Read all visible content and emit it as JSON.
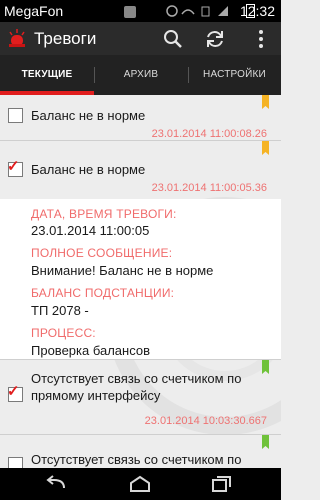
{
  "status_bar": {
    "carrier": "MegaFon",
    "time": "12:32"
  },
  "app_bar": {
    "title": "Тревоги",
    "icons": [
      "alarm-siren-icon",
      "search-icon",
      "refresh-icon",
      "overflow-menu-icon"
    ]
  },
  "tabs": [
    {
      "label": "ТЕКУЩИЕ",
      "active": true
    },
    {
      "label": "АРХИВ",
      "active": false
    },
    {
      "label": "НАСТРОЙКИ",
      "active": false
    }
  ],
  "alarms": [
    {
      "text": "Баланс не в норме",
      "date": "23.01.2014 11:00:08.26",
      "checked": false,
      "color": "#f5b324"
    },
    {
      "text": "Баланс не в норме",
      "date": "23.01.2014 11:00:05.36",
      "checked": true,
      "color": "#f5b324"
    },
    {
      "text": "Отсутствует связь со счетчиком по прямому интерфейсу",
      "date": "23.01.2014 10:03:30.667",
      "checked": true,
      "color": "#6fc23a"
    },
    {
      "text": "Отсутствует связь со счетчиком по",
      "checked": false,
      "color": "#6fc23a"
    }
  ],
  "details": {
    "datetime_label": "ДАТА, ВРЕМЯ ТРЕВОГИ:",
    "datetime_value": "23.01.2014 11:00:05",
    "message_label": "ПОЛНОЕ СООБЩЕНИЕ:",
    "message_value": "Внимание! Баланс не в норме",
    "substation_label": "БАЛАНС ПОДСТАНЦИИ:",
    "substation_value": "ТП 2078 -",
    "process_label": "ПРОЦЕСС:",
    "process_value": "Проверка балансов"
  },
  "nav_bar": {
    "icons": [
      "back-icon",
      "home-icon",
      "recent-apps-icon"
    ]
  }
}
